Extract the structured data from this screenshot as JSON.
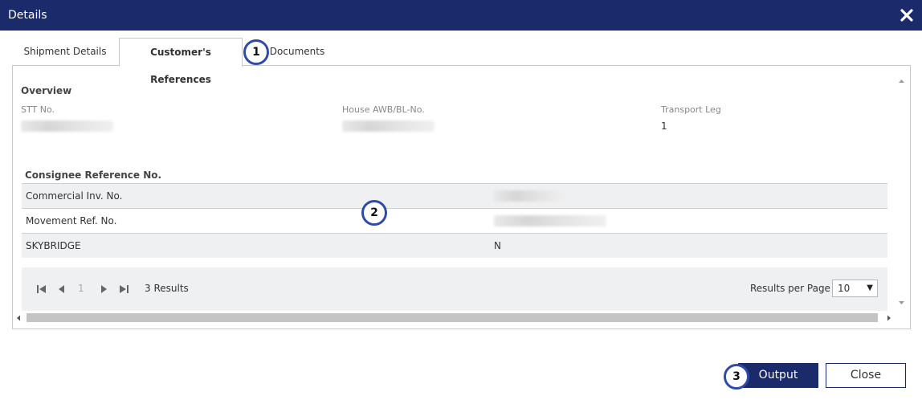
{
  "dialog": {
    "title": "Details"
  },
  "tabs": [
    {
      "label": "Shipment Details",
      "active": false
    },
    {
      "label": "Customer's References",
      "active": true
    },
    {
      "label": "Documents",
      "active": false
    }
  ],
  "badges": [
    "1",
    "2",
    "3"
  ],
  "overview": {
    "title": "Overview",
    "fields": [
      {
        "label": "STT No.",
        "value": ""
      },
      {
        "label": "House AWB/BL-No.",
        "value": ""
      },
      {
        "label": "Transport Leg",
        "value": "1"
      }
    ]
  },
  "references": {
    "header": "Consignee Reference No.",
    "rows": [
      {
        "name": "Commercial Inv. No.",
        "value": ""
      },
      {
        "name": "Movement Ref. No.",
        "value": ""
      },
      {
        "name": "SKYBRIDGE",
        "value": "N"
      }
    ]
  },
  "pager": {
    "page": "1",
    "results": "3 Results",
    "rpp_label": "Results per Page",
    "rpp_value": "10"
  },
  "footer": {
    "output_label": "Output",
    "close_label": "Close"
  },
  "colors": {
    "header_bg": "#1b2a6b",
    "badge_border": "#2f4ba8",
    "row_alt": "#eef0f2"
  }
}
